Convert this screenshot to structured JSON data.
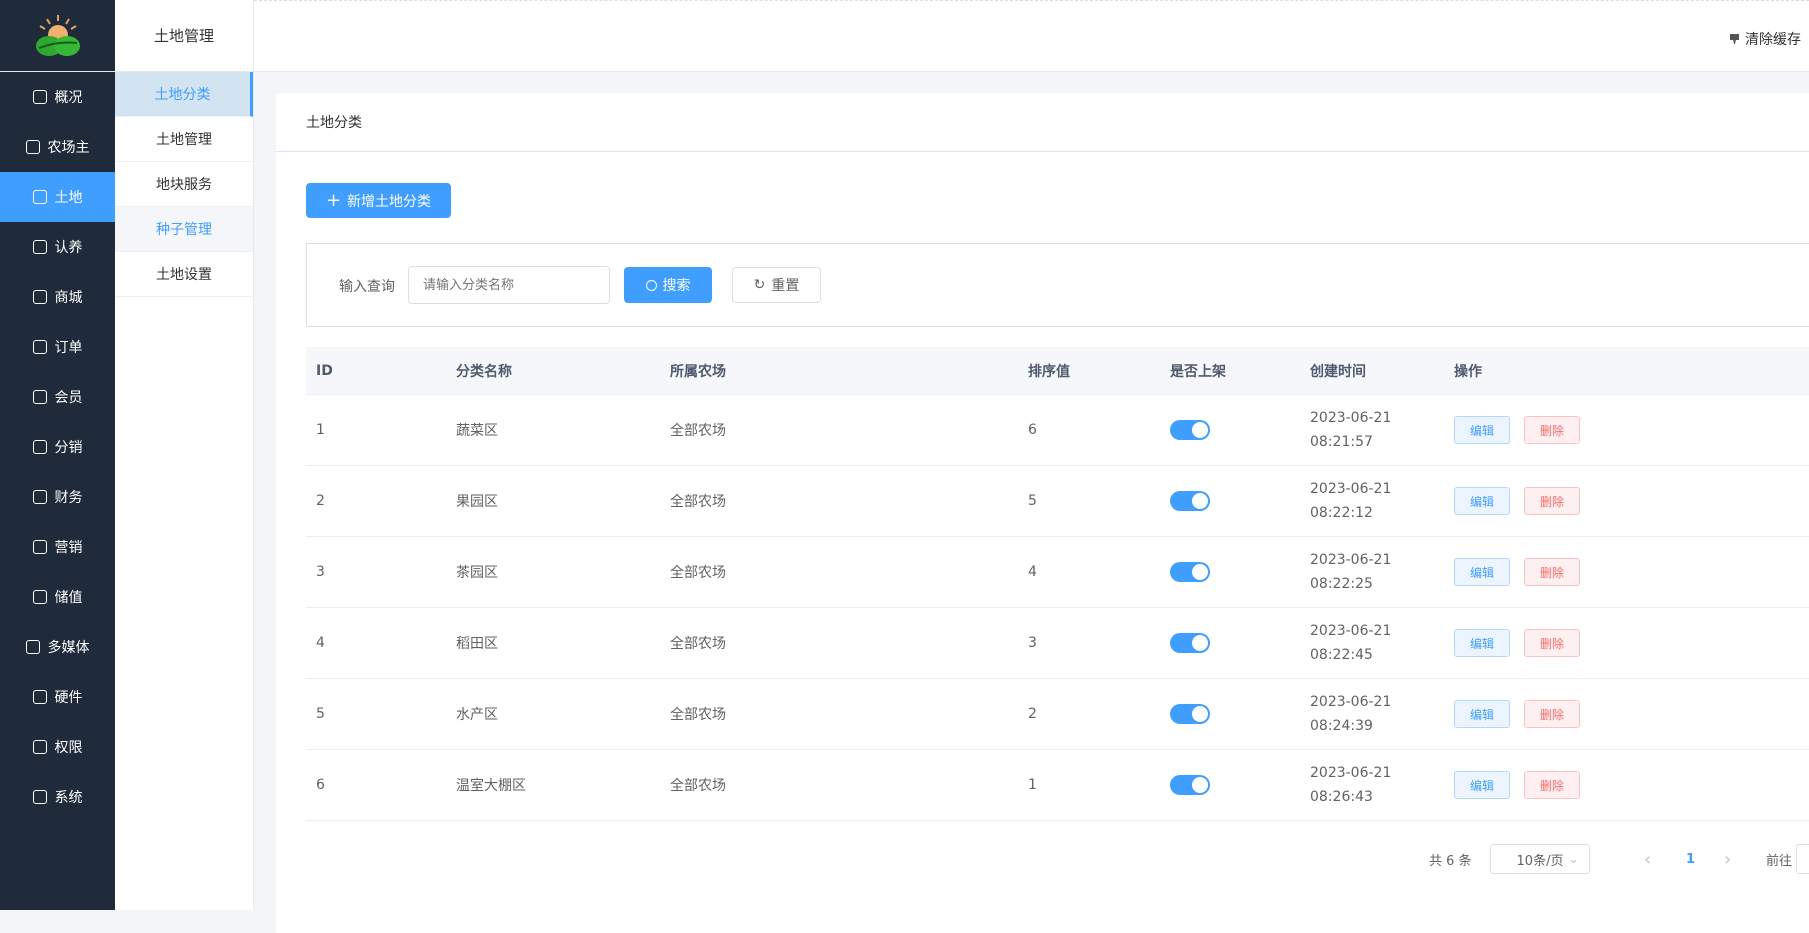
{
  "sidebar": {
    "items": [
      {
        "label": "概况",
        "icon": "home-icon"
      },
      {
        "label": "农场主",
        "icon": "user-stamp-icon"
      },
      {
        "label": "土地",
        "icon": "land-icon",
        "active": true
      },
      {
        "label": "认养",
        "icon": "apple-icon"
      },
      {
        "label": "商城",
        "icon": "store-icon"
      },
      {
        "label": "订单",
        "icon": "clipboard-icon"
      },
      {
        "label": "会员",
        "icon": "user-icon"
      },
      {
        "label": "分销",
        "icon": "share-tree-icon"
      },
      {
        "label": "财务",
        "icon": "pie-chart-icon"
      },
      {
        "label": "营销",
        "icon": "calendar-icon"
      },
      {
        "label": "储值",
        "icon": "wallet-icon"
      },
      {
        "label": "多媒体",
        "icon": "monitor-icon"
      },
      {
        "label": "硬件",
        "icon": "hardware-icon"
      },
      {
        "label": "权限",
        "icon": "permission-icon"
      },
      {
        "label": "系统",
        "icon": "gear-icon"
      }
    ]
  },
  "submenu": {
    "title": "土地管理",
    "items": [
      {
        "label": "土地分类",
        "state": "active"
      },
      {
        "label": "土地管理",
        "state": ""
      },
      {
        "label": "地块服务",
        "state": ""
      },
      {
        "label": "种子管理",
        "state": "hover"
      },
      {
        "label": "土地设置",
        "state": ""
      }
    ]
  },
  "header": {
    "clear_cache": "清除缓存"
  },
  "card": {
    "title": "土地分类",
    "add_button": "新增土地分类"
  },
  "search": {
    "label": "输入查询",
    "placeholder": "请输入分类名称",
    "search_button": "搜索",
    "reset_button": "重置"
  },
  "table": {
    "headers": [
      "ID",
      "分类名称",
      "所属农场",
      "排序值",
      "是否上架",
      "创建时间",
      "操作"
    ],
    "edit_label": "编辑",
    "delete_label": "删除",
    "rows": [
      {
        "id": "1",
        "name": "蔬菜区",
        "farm": "全部农场",
        "sort": "6",
        "on_shelf": true,
        "date": "2023-06-21",
        "time": "08:21:57"
      },
      {
        "id": "2",
        "name": "果园区",
        "farm": "全部农场",
        "sort": "5",
        "on_shelf": true,
        "date": "2023-06-21",
        "time": "08:22:12"
      },
      {
        "id": "3",
        "name": "茶园区",
        "farm": "全部农场",
        "sort": "4",
        "on_shelf": true,
        "date": "2023-06-21",
        "time": "08:22:25"
      },
      {
        "id": "4",
        "name": "稻田区",
        "farm": "全部农场",
        "sort": "3",
        "on_shelf": true,
        "date": "2023-06-21",
        "time": "08:22:45"
      },
      {
        "id": "5",
        "name": "水产区",
        "farm": "全部农场",
        "sort": "2",
        "on_shelf": true,
        "date": "2023-06-21",
        "time": "08:24:39"
      },
      {
        "id": "6",
        "name": "温室大棚区",
        "farm": "全部农场",
        "sort": "1",
        "on_shelf": true,
        "date": "2023-06-21",
        "time": "08:26:43"
      }
    ]
  },
  "pagination": {
    "total": "共 6 条",
    "page_size": "10条/页",
    "current": "1",
    "goto": "前往"
  }
}
